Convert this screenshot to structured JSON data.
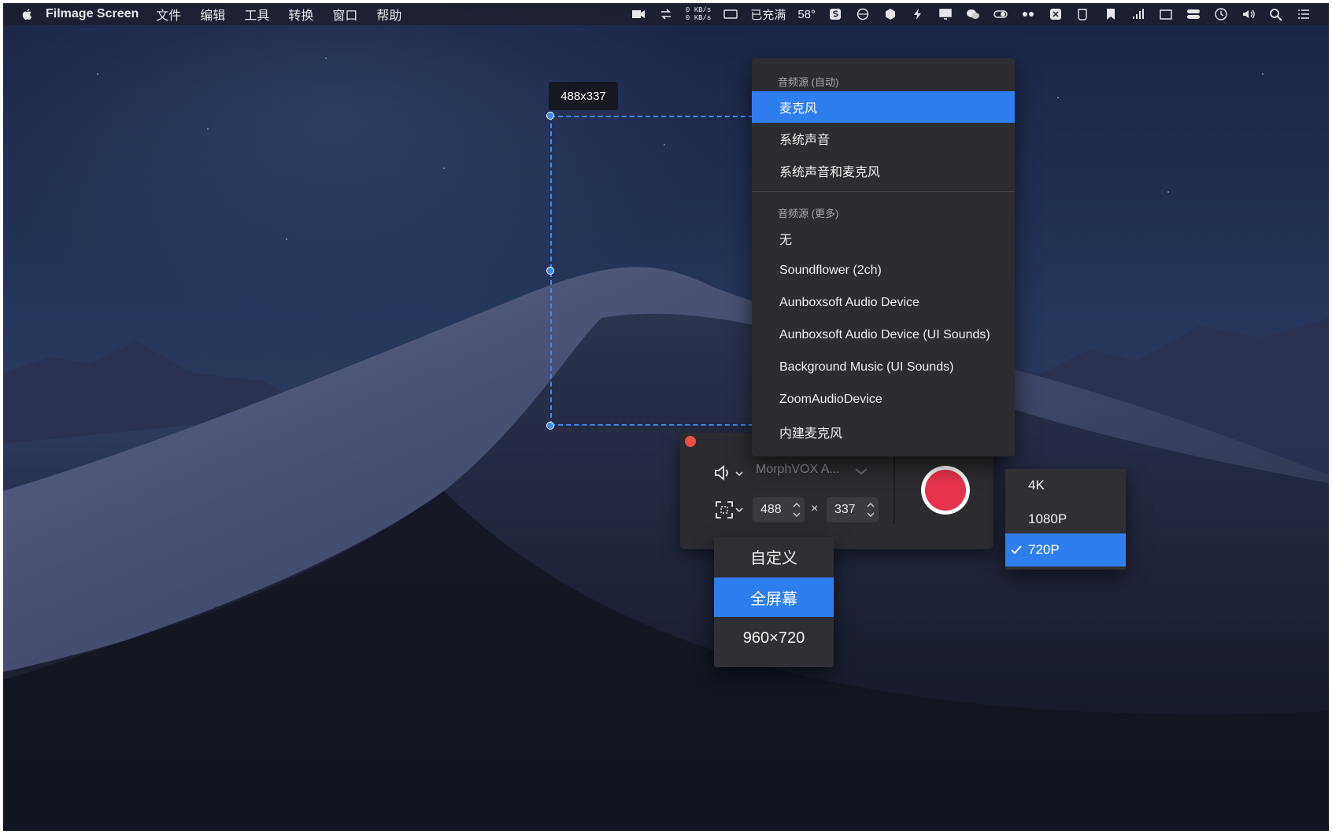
{
  "menubar": {
    "app_name": "Filmage Screen",
    "menus": [
      "文件",
      "编辑",
      "工具",
      "转换",
      "窗口",
      "帮助"
    ],
    "status": {
      "net_up": "0 KB/s",
      "net_down": "0 KB/s",
      "battery": "已充满",
      "temperature": "58°"
    },
    "icons": [
      "apple-icon",
      "camera-icon",
      "rotate-icon",
      "display-icon",
      "s-icon",
      "globe-icon",
      "hex-icon",
      "bolt-icon",
      "monitor-icon",
      "wechat-icon",
      "toggle-icon",
      "dots-icon",
      "x-box-icon",
      "cup-icon",
      "bookmark-icon",
      "signal-icon",
      "cast-icon",
      "control-center-icon",
      "clock-icon",
      "volume-icon",
      "search-icon",
      "list-icon"
    ]
  },
  "selection": {
    "size_label": "488x337"
  },
  "audio_menu": {
    "header_auto": "音频源 (自动)",
    "auto_items": [
      "麦克风",
      "系统声音",
      "系统声音和麦克风"
    ],
    "selected_item": "麦克风",
    "header_more": "音频源 (更多)",
    "more_items": [
      "无",
      "Soundflower (2ch)",
      "Aunboxsoft Audio Device",
      "Aunboxsoft Audio Device (UI Sounds)",
      "Background Music (UI Sounds)",
      "ZoomAudioDevice",
      "内建麦克风"
    ]
  },
  "panel": {
    "audio_source": "MorphVOX A...",
    "width": "488",
    "height": "337",
    "times_symbol": "×"
  },
  "size_menu": {
    "options": [
      "自定义",
      "全屏幕",
      "960×720"
    ],
    "selected": "全屏幕"
  },
  "resolution_menu": {
    "options": [
      "4K",
      "1080P",
      "720P"
    ],
    "selected": "720P"
  },
  "colors": {
    "accent": "#2f7ef0",
    "record": "#e8334e",
    "selection": "#3d8af7",
    "close": "#ee4b47"
  }
}
